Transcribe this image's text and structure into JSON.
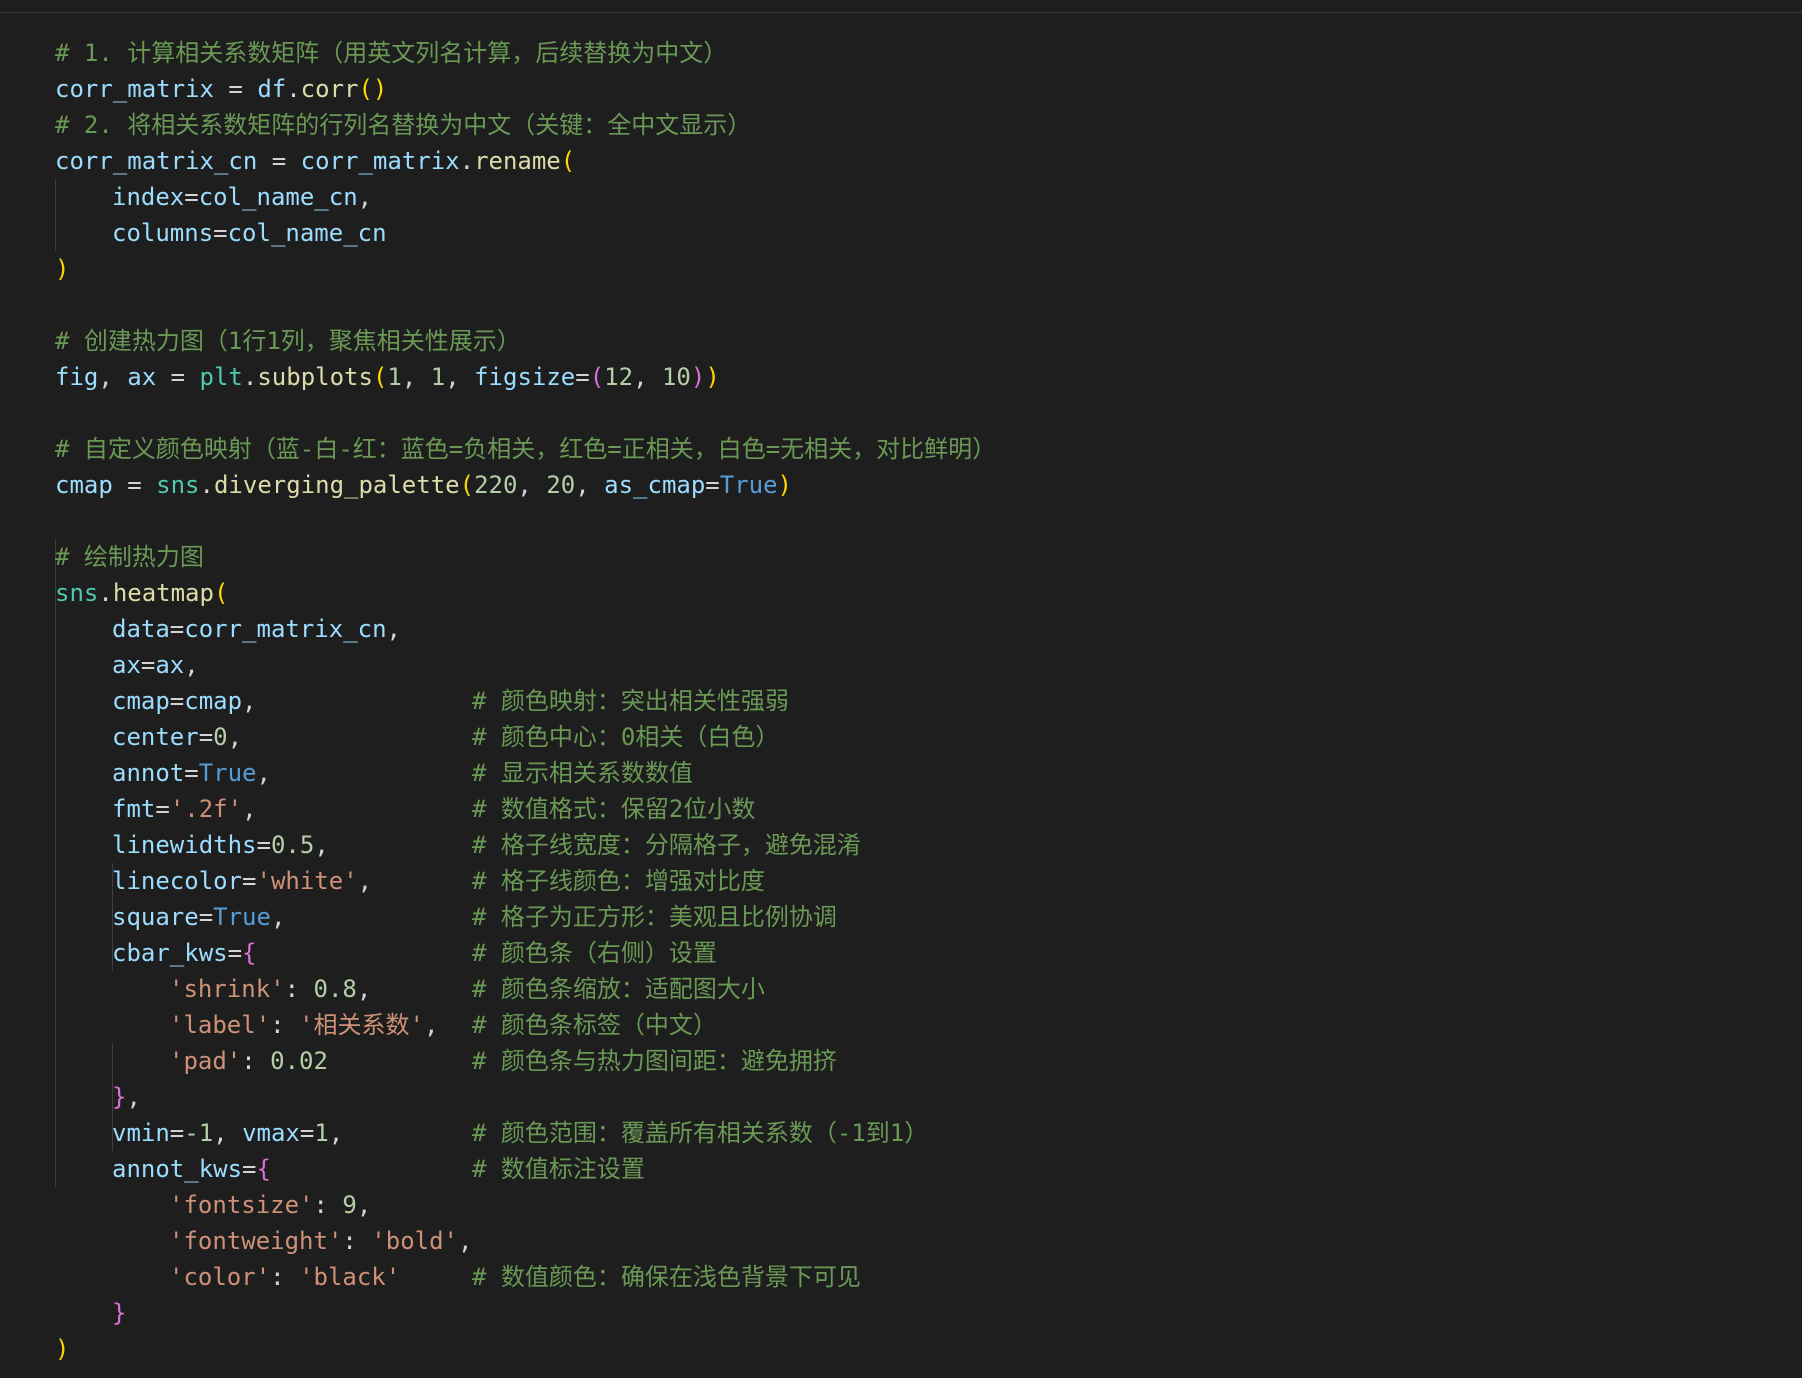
{
  "code": {
    "comment_1": "# 1. 计算相关系数矩阵（用英文列名计算，后续替换为中文）",
    "comment_2": "# 2. 将相关系数矩阵的行列名替换为中文（关键：全中文显示）",
    "comment_heatmap_create": "# 创建热力图（1行1列，聚焦相关性展示）",
    "comment_cmap": "# 自定义颜色映射（蓝-白-红：蓝色=负相关，红色=正相关，白色=无相关，对比鲜明）",
    "comment_draw": "# 绘制热力图",
    "inline_comments": {
      "cmap": "# 颜色映射：突出相关性强弱",
      "center": "# 颜色中心：0相关（白色）",
      "annot": "# 显示相关系数数值",
      "fmt": "# 数值格式：保留2位小数",
      "linewidths": "# 格子线宽度：分隔格子，避免混淆",
      "linecolor": "# 格子线颜色：增强对比度",
      "square": "# 格子为正方形：美观且比例协调",
      "cbar_kws": "# 颜色条（右侧）设置",
      "shrink": "# 颜色条缩放：适配图大小",
      "label": "# 颜色条标签（中文）",
      "pad": "# 颜色条与热力图间距：避免拥挤",
      "vrange": "# 颜色范围：覆盖所有相关系数（-1到1）",
      "annot_kws": "# 数值标注设置",
      "color": "# 数值颜色：确保在浅色背景下可见"
    },
    "strings": {
      "fmt": "'.2f'",
      "white": "'white'",
      "shrink_key": "'shrink'",
      "label_key": "'label'",
      "label_val": "'相关系数'",
      "pad_key": "'pad'",
      "fontsize_key": "'fontsize'",
      "fontweight_key": "'fontweight'",
      "bold": "'bold'",
      "color_key": "'color'",
      "black": "'black'"
    },
    "numbers": {
      "one": "1",
      "twelve": "12",
      "ten": "10",
      "n220": "220",
      "n20": "20",
      "zero": "0",
      "lw": "0.5",
      "shrink": "0.8",
      "pad": "0.02",
      "neg_one": "-1",
      "nine": "9"
    },
    "keywords": {
      "true": "True"
    }
  },
  "colors": {
    "background": "#1e1e1e",
    "comment": "#6a9955",
    "variable": "#9cdcfe",
    "function": "#dcdcaa",
    "module": "#4ec9b0",
    "number": "#b5cea8",
    "string": "#ce9178",
    "keyword": "#569cd6",
    "bracket_gold": "#ffd700",
    "bracket_purple": "#da70d6"
  }
}
